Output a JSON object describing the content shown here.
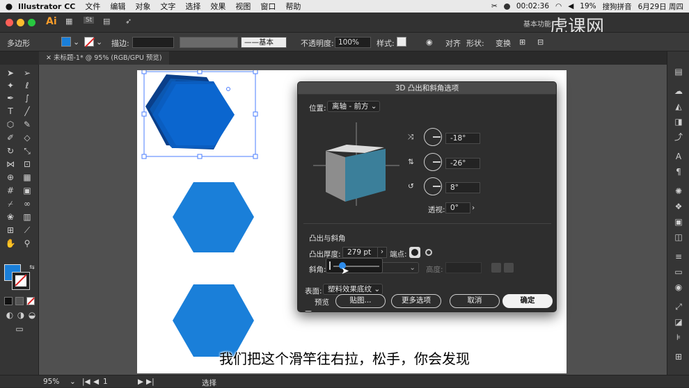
{
  "menubar": {
    "apple": "",
    "app_name": "Illustrator CC",
    "items": [
      "文件",
      "编辑",
      "对象",
      "文字",
      "选择",
      "效果",
      "视图",
      "窗口",
      "帮助"
    ],
    "recording_time": "00:02:36",
    "battery": "19%",
    "input_method": "搜狗拼音",
    "date": "6月29日 周四"
  },
  "appbar": {
    "logo": "Ai",
    "workspace": "基本功能",
    "watermark": "虎课网"
  },
  "control_bar": {
    "object_type": "多边形",
    "stroke_label": "描边:",
    "stroke_style": "基本",
    "opacity_label": "不透明度:",
    "opacity_value": "100%",
    "style_label": "样式:",
    "align_label": "对齐",
    "shape_label": "形状:",
    "transform_label": "变换"
  },
  "tab": {
    "label": "未标题-1* @ 95% (RGB/GPU 预览)"
  },
  "status": {
    "zoom": "95%",
    "artboard_num": "1",
    "tool": "选择"
  },
  "dialog": {
    "title": "3D 凸出和斜角选项",
    "position_label": "位置:",
    "position_value": "离轴 - 前方",
    "rot_x": "-18°",
    "rot_y": "-26°",
    "rot_z": "8°",
    "perspective_label": "透视:",
    "perspective_value": "0°",
    "section_label": "凸出与斜角",
    "depth_label": "凸出厚度:",
    "depth_value": "279 pt",
    "cap_label": "端点:",
    "bevel_label": "斜角:",
    "height_label": "高度:",
    "surface_label": "表面:",
    "surface_value": "塑料效果底纹",
    "preview_label": "预览",
    "map_button": "贴图...",
    "more_button": "更多选项",
    "cancel_button": "取消",
    "ok_button": "确定"
  },
  "subtitle": "我们把这个滑竿往右拉，松手，你会发现",
  "colors": {
    "hex_blue": "#0b72c9",
    "hex_dark": "#0a4a9e",
    "fill_swatch": "#1a7fd9"
  }
}
